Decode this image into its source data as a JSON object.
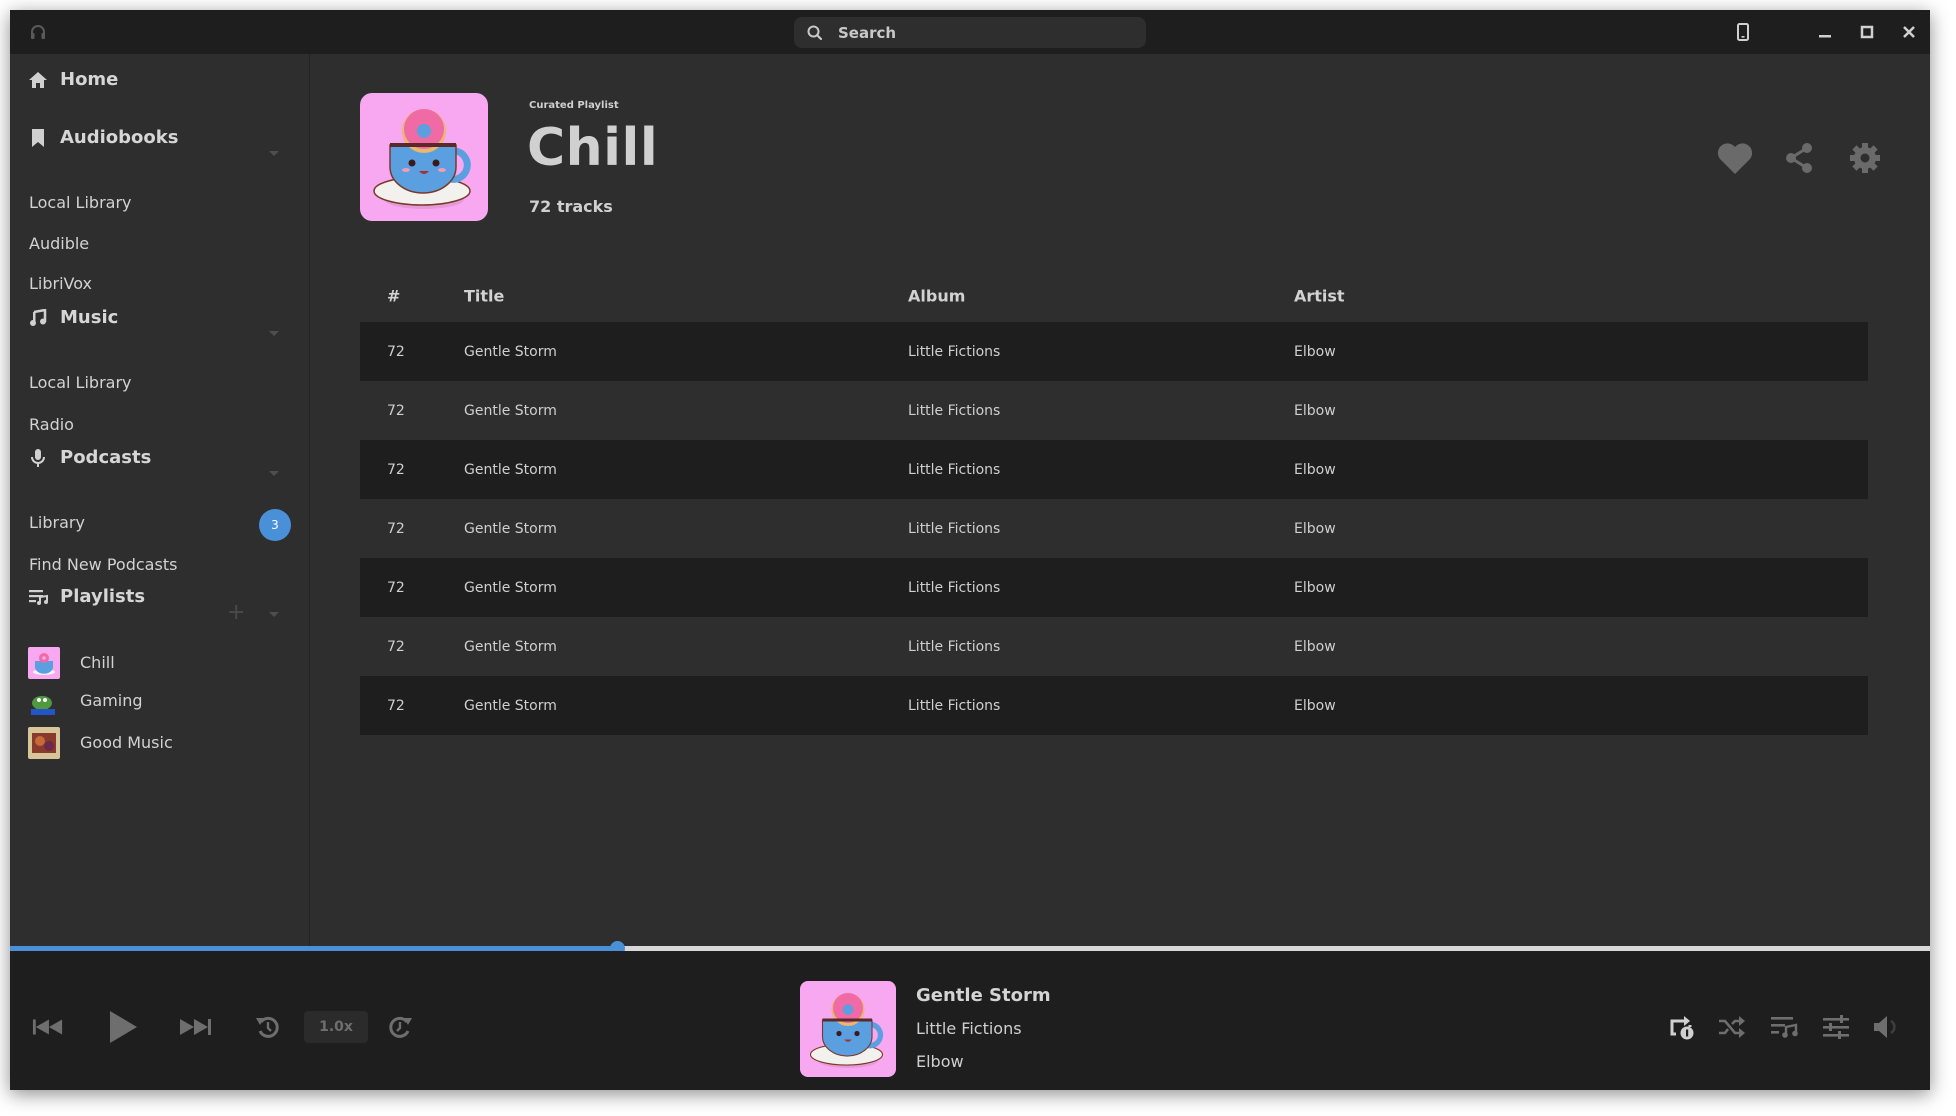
{
  "titlebar": {
    "app_icon": "headphones-icon",
    "search_placeholder": "Search",
    "controls": [
      "mobile-view-icon",
      "minimize-icon",
      "maximize-icon",
      "close-icon"
    ]
  },
  "sidebar": {
    "home": {
      "label": "Home",
      "icon": "home-icon"
    },
    "sections": [
      {
        "label": "Audiobooks",
        "icon": "bookmark-icon",
        "items": [
          "Local Library",
          "Audible",
          "LibriVox"
        ]
      },
      {
        "label": "Music",
        "icon": "music-note-icon",
        "items": [
          "Local Library",
          "Radio"
        ]
      },
      {
        "label": "Podcasts",
        "icon": "microphone-icon",
        "items": [
          "Library",
          "Find New Podcasts"
        ],
        "library_badge": "3"
      },
      {
        "label": "Playlists",
        "icon": "playlist-icon",
        "add_label": "+"
      }
    ],
    "playlists": [
      {
        "label": "Chill",
        "thumb": "cup-donut-art"
      },
      {
        "label": "Gaming",
        "thumb": "frog-art"
      },
      {
        "label": "Good Music",
        "thumb": "album-art"
      }
    ]
  },
  "playlist": {
    "subtitle": "Curated Playlist",
    "title": "Chill",
    "track_count": "72 tracks",
    "actions": [
      "heart-icon",
      "share-icon",
      "settings-icon"
    ]
  },
  "table": {
    "headers": {
      "num": "#",
      "title": "Title",
      "album": "Album",
      "artist": "Artist"
    },
    "rows": [
      {
        "num": "72",
        "title": "Gentle Storm",
        "album": "Little Fictions",
        "artist": "Elbow"
      },
      {
        "num": "72",
        "title": "Gentle Storm",
        "album": "Little Fictions",
        "artist": "Elbow"
      },
      {
        "num": "72",
        "title": "Gentle Storm",
        "album": "Little Fictions",
        "artist": "Elbow"
      },
      {
        "num": "72",
        "title": "Gentle Storm",
        "album": "Little Fictions",
        "artist": "Elbow"
      },
      {
        "num": "72",
        "title": "Gentle Storm",
        "album": "Little Fictions",
        "artist": "Elbow"
      },
      {
        "num": "72",
        "title": "Gentle Storm",
        "album": "Little Fictions",
        "artist": "Elbow"
      },
      {
        "num": "72",
        "title": "Gentle Storm",
        "album": "Little Fictions",
        "artist": "Elbow"
      }
    ]
  },
  "player": {
    "progress_fraction": 0.316,
    "speed_label": "1.0x",
    "now_playing": {
      "title": "Gentle Storm",
      "album": "Little Fictions",
      "artist": "Elbow"
    },
    "colors": {
      "accent": "#4a90d9"
    }
  }
}
